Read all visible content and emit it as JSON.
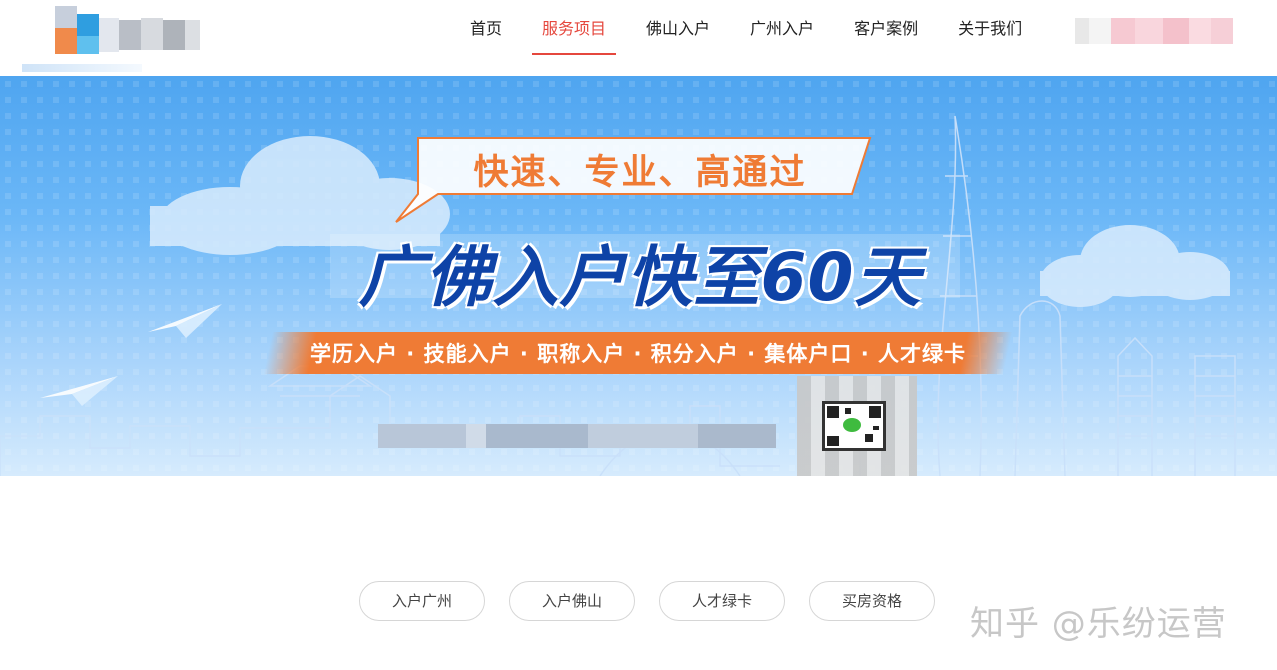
{
  "header": {
    "nav": [
      {
        "label": "首页",
        "active": false
      },
      {
        "label": "服务项目",
        "active": true
      },
      {
        "label": "佛山入户",
        "active": false
      },
      {
        "label": "广州入户",
        "active": false
      },
      {
        "label": "客户案例",
        "active": false
      },
      {
        "label": "关于我们",
        "active": false
      }
    ],
    "accent_color": "#e5473d"
  },
  "banner": {
    "tagline": "快速、专业、高通过",
    "title": "广佛入户快至60天",
    "services": "学历入户 · 技能入户 · 职称入户 · 积分入户 · 集体户口 · 人才绿卡",
    "tagline_color": "#ef7b35",
    "title_color": "#0e43a7",
    "qr_icon": "wechat-qr-icon"
  },
  "filters": [
    {
      "label": "入户广州"
    },
    {
      "label": "入户佛山"
    },
    {
      "label": "人才绿卡"
    },
    {
      "label": "买房资格"
    }
  ],
  "watermark": "知乎 @乐纷运营"
}
